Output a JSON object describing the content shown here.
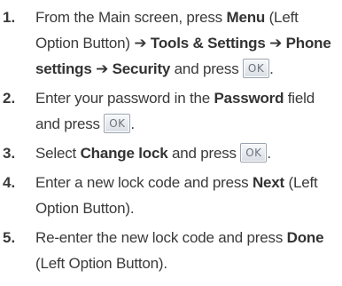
{
  "ok_button": {
    "label": "OK"
  },
  "steps": [
    {
      "number": "1.",
      "t1": "From the Main screen, press ",
      "b1": "Menu",
      "t2": " (Left Option Button) ➔ ",
      "b2": "Tools & Settings ➔ Phone settings ➔ Security",
      "t3": " and press ",
      "t4": "."
    },
    {
      "number": "2.",
      "t1": "Enter your password in the ",
      "b1": "Password",
      "t2": " field and press ",
      "t3": "."
    },
    {
      "number": "3.",
      "t1": "Select ",
      "b1": "Change lock",
      "t2": " and press ",
      "t3": "."
    },
    {
      "number": "4.",
      "t1": "Enter a new lock code and press ",
      "b1": "Next",
      "t2": " (Left Option Button)."
    },
    {
      "number": "5.",
      "t1": "Re-enter the new lock code and press ",
      "b1": "Done",
      "t2": " (Left Option Button)."
    }
  ]
}
